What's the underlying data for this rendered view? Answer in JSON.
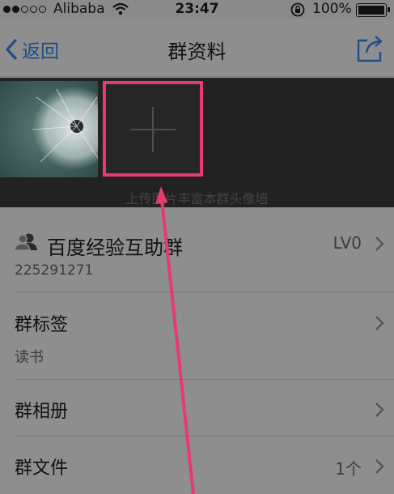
{
  "status_bar": {
    "carrier": "Alibaba",
    "time": "23:47",
    "battery": "100%"
  },
  "nav": {
    "back_label": "返回",
    "title": "群资料"
  },
  "photo_wall": {
    "hint": "上传图片丰富本群头像墙"
  },
  "group": {
    "name": "百度经验互助群",
    "level": "LV0",
    "id": "225291271"
  },
  "rows": {
    "tags_title": "群标签",
    "tags_value": "读书",
    "album_title": "群相册",
    "files_title": "群文件",
    "files_count": "1个"
  },
  "colors": {
    "highlight": "#e83a6e",
    "accent": "#1d4e88",
    "overlay": "#8e8e8e"
  }
}
